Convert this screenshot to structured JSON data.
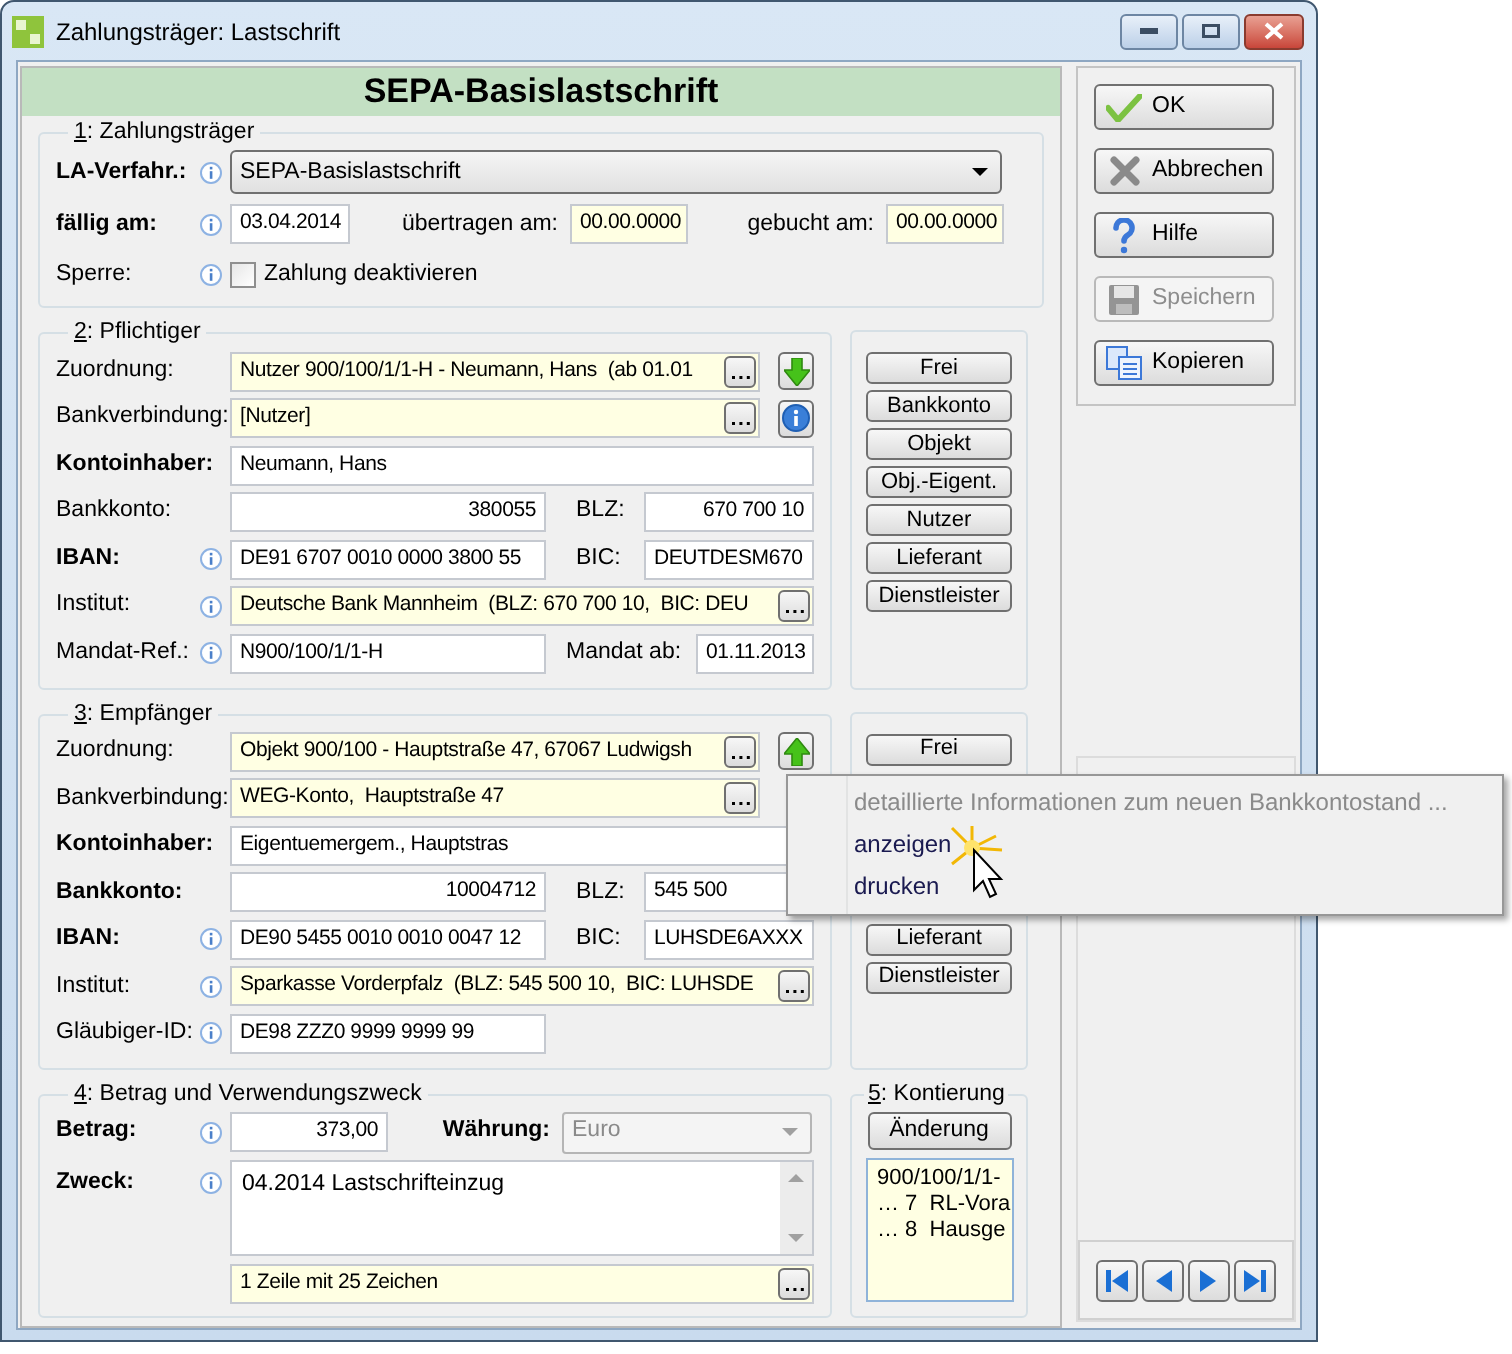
{
  "window": {
    "title": "Zahlungsträger: Lastschrift"
  },
  "header": "SEPA-Basislastschrift",
  "payment": {
    "title": "1: Zahlungsträger",
    "method": {
      "label": "LA-Verfahr.:",
      "value": "SEPA-Basislastschrift",
      "bold": true,
      "info": true
    },
    "due": {
      "label": "fällig am:",
      "value": "03.04.2014",
      "bold": true,
      "info": true,
      "readonly": false
    },
    "transferred": {
      "label": "übertragen am:",
      "value": "00.00.0000",
      "readonly": true
    },
    "booked": {
      "label": "gebucht am:",
      "value": "00.00.0000",
      "readonly": true
    },
    "lock": {
      "label": "Sperre:",
      "info": true,
      "option": "Zahlung deaktivieren",
      "checked": false
    }
  },
  "parties": [
    {
      "title": "2: Pflichtiger",
      "rows": [
        {
          "kind": "linked",
          "label": "Zuordnung:",
          "value": "Nutzer 900/100/1/1-H - Neumann, Hans  (ab 01.01",
          "readonly": true,
          "side_button": {
            "kind": "arrow-down"
          }
        },
        {
          "kind": "linked",
          "label": "Bankverbindung:",
          "value": "[Nutzer]",
          "readonly": true,
          "side_button": {
            "kind": "info"
          }
        },
        {
          "kind": "full",
          "label": "Kontoinhaber:",
          "value": "Neumann, Hans",
          "bold": true,
          "readonly": false
        },
        {
          "kind": "pair",
          "label": "Bankkonto:",
          "value": "380055",
          "right_aligned": true,
          "second_label": "BLZ:",
          "second_value": "670 700 10",
          "second_right_aligned": true
        },
        {
          "kind": "pair",
          "label": "IBAN:",
          "bold": true,
          "info": true,
          "value": "DE91 6707 0010 0000 3800 55",
          "right_aligned": false,
          "second_label": "BIC:",
          "second_value": "DEUTDESM670",
          "second_right_aligned": false
        },
        {
          "kind": "full",
          "label": "Institut:",
          "info": true,
          "value": "Deutsche Bank Mannheim  (BLZ: 670 700 10,  BIC: DEU",
          "readonly": true,
          "more": true
        },
        {
          "kind": "mandate",
          "label": "Mandat-Ref.:",
          "info": true,
          "value": "N900/100/1/1-H",
          "right_aligned": false,
          "second_label": "Mandat ab:",
          "second_value": "01.11.2013",
          "second_right_aligned": false
        }
      ],
      "buttons": [
        "Frei",
        "Bankkonto",
        "Objekt",
        "Obj.-Eigent.",
        "Nutzer",
        "Lieferant",
        "Dienstleister"
      ]
    },
    {
      "title": "3: Empfänger",
      "rows": [
        {
          "kind": "linked",
          "label": "Zuordnung:",
          "value": "Objekt 900/100 - Hauptstraße 47, 67067 Ludwigsh",
          "readonly": true,
          "side_button": {
            "kind": "arrow-up"
          }
        },
        {
          "kind": "linked",
          "label": "Bankverbindung:",
          "value": "WEG-Konto,  Hauptstraße 47",
          "readonly": true
        },
        {
          "kind": "full",
          "label": "Kontoinhaber:",
          "value": "Eigentuemergem., Hauptstras",
          "bold": true,
          "readonly": false
        },
        {
          "kind": "pair",
          "label": "Bankkonto:",
          "bold": true,
          "value": "10004712",
          "right_aligned": true,
          "second_label": "BLZ:",
          "second_value": "545 500",
          "second_right_aligned": false
        },
        {
          "kind": "pair",
          "label": "IBAN:",
          "bold": true,
          "info": true,
          "value": "DE90 5455 0010 0010 0047 12",
          "right_aligned": false,
          "second_label": "BIC:",
          "second_value": "LUHSDE6AXXX",
          "second_right_aligned": false
        },
        {
          "kind": "full",
          "label": "Institut:",
          "info": true,
          "value": "Sparkasse Vorderpfalz  (BLZ: 545 500 10,  BIC: LUHSDE",
          "readonly": true,
          "more": true
        },
        {
          "kind": "single",
          "label": "Gläubiger-ID:",
          "info": true,
          "value": "DE98 ZZZ0 9999 9999 99",
          "right_aligned": false
        }
      ],
      "buttons": [
        "Frei",
        "Lieferant",
        "Dienstleister"
      ]
    }
  ],
  "amount": {
    "title": "4: Betrag und Verwendungszweck",
    "amount": {
      "label": "Betrag:",
      "value": "373,00",
      "bold": true,
      "info": true
    },
    "currency": {
      "label": "Währung:",
      "value": "Euro",
      "bold": true,
      "disabled": true
    },
    "purpose": {
      "label": "Zweck:",
      "value": "04.2014 Lastschrifteinzug",
      "bold": true,
      "info": true
    },
    "counter": "1 Zeile mit 25 Zeichen"
  },
  "accounting": {
    "title": "5: Kontierung",
    "button": "Änderung",
    "lines": [
      "900/100/1/1-",
      "… 7  RL-Vora",
      "… 8  Hausge"
    ]
  },
  "actions": [
    {
      "label": "OK",
      "kind": "check",
      "disabled": false
    },
    {
      "label": "Abbrechen",
      "kind": "cancel",
      "disabled": false
    },
    {
      "label": "Hilfe",
      "kind": "help",
      "disabled": false
    },
    {
      "label": "Speichern",
      "kind": "save",
      "disabled": true
    },
    {
      "label": "Kopieren",
      "kind": "copy",
      "disabled": false
    }
  ],
  "navigation": [
    {
      "kind": "first"
    },
    {
      "kind": "previous"
    },
    {
      "kind": "next"
    },
    {
      "kind": "last"
    }
  ],
  "context_menu": {
    "items": [
      {
        "label": "detaillierte Informationen zum neuen Bankkontostand ...",
        "disabled": true
      },
      {
        "label": "anzeigen",
        "disabled": false
      },
      {
        "label": "drucken",
        "disabled": false
      }
    ]
  }
}
